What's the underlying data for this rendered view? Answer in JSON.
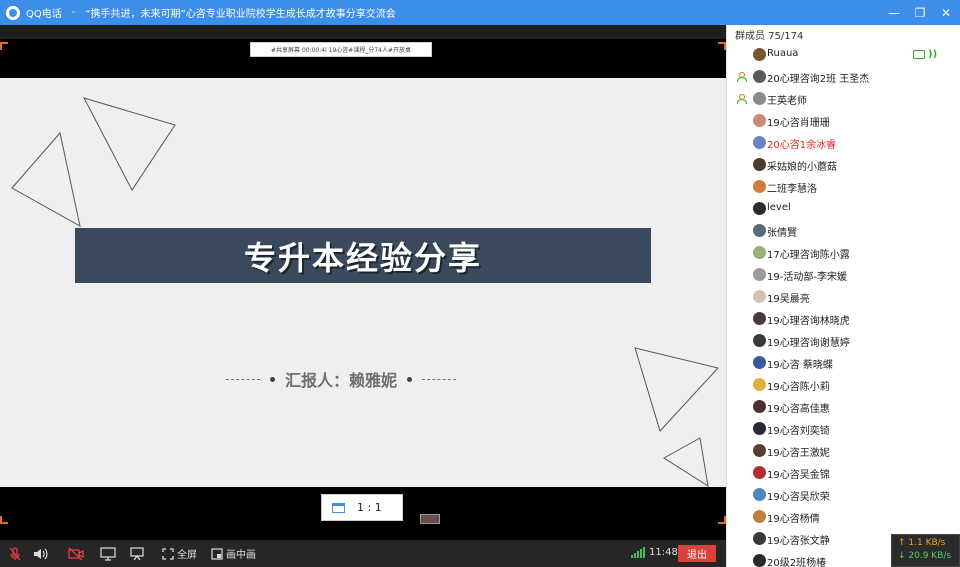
{
  "window": {
    "app_name": "QQ电话",
    "title_separator": "-",
    "title": "“携手共进，未来可期”心咨专业职业院校学生成长成才故事分享交流会",
    "minimize_glyph": "—",
    "restore_glyph": "❐",
    "close_glyph": "✕"
  },
  "share_strip": {
    "text": "#共享屏幕 00:00:4l 19心咨#课程_分74人#开放桌"
  },
  "slide": {
    "title": "专升本经验分享",
    "reporter": "汇报人：赖雅妮"
  },
  "view_controls": {
    "ratio_label": "1 : 1"
  },
  "toolbar": {
    "fullscreen_label": "全屏",
    "pip_label": "画中画",
    "time": "11:48",
    "leave_label": "退出"
  },
  "sidebar": {
    "header": "群成员 75/174",
    "members": [
      {
        "name": "Ruaua",
        "role": "",
        "color": "#7a5533",
        "speaking": true
      },
      {
        "name": "20心理咨询2班 王圣杰",
        "role": "admin",
        "color": "#5a5a5a"
      },
      {
        "name": "王英老师",
        "role": "admin",
        "color": "#8a8a8a"
      },
      {
        "name": "19心咨肖珊珊",
        "role": "",
        "color": "#c98a7a"
      },
      {
        "name": "20心咨1余冰睿",
        "role": "",
        "color": "#6a84c4",
        "highlight": true
      },
      {
        "name": "采姑娘的小蘑菇",
        "role": "",
        "color": "#4b3a2d"
      },
      {
        "name": "二班李慧洛",
        "role": "",
        "color": "#d47a3c"
      },
      {
        "name": "level",
        "role": "",
        "color": "#2d2d2d"
      },
      {
        "name": "张倩賢",
        "role": "",
        "color": "#5a6a7a"
      },
      {
        "name": "17心理咨询陈小露",
        "role": "",
        "color": "#9ab07a"
      },
      {
        "name": "19-活动部-李宋媛",
        "role": "",
        "color": "#9a9a9a"
      },
      {
        "name": "19吴晨亮",
        "role": "",
        "color": "#d8c0b0"
      },
      {
        "name": "19心理咨询林晓虎",
        "role": "",
        "color": "#4a3a3a"
      },
      {
        "name": "19心理咨询谢慧婷",
        "role": "",
        "color": "#3a3a3a"
      },
      {
        "name": "19心咨 蔡晓蝶",
        "role": "",
        "color": "#3a5a9a"
      },
      {
        "name": "19心咨陈小莉",
        "role": "",
        "color": "#e0b040"
      },
      {
        "name": "19心咨高佳惠",
        "role": "",
        "color": "#4a3030"
      },
      {
        "name": "19心咨刘奕锜",
        "role": "",
        "color": "#2a2a3a"
      },
      {
        "name": "19心咨王激妮",
        "role": "",
        "color": "#5a4030"
      },
      {
        "name": "19心咨吴金锦",
        "role": "",
        "color": "#b03030"
      },
      {
        "name": "19心咨吴欣荣",
        "role": "",
        "color": "#4a8ac0"
      },
      {
        "name": "19心咨杨倩",
        "role": "",
        "color": "#c08040"
      },
      {
        "name": "19心咨张文静",
        "role": "",
        "color": "#3a3a3a"
      },
      {
        "name": "20级2班杨椿",
        "role": "",
        "color": "#2a2a2a"
      }
    ]
  },
  "network": {
    "upload": "↑ 1.1 KB/s",
    "download": "↓ 20.9 KB/s"
  }
}
